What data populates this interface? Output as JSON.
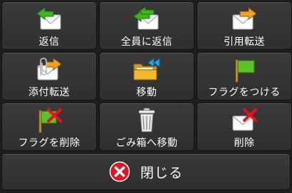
{
  "menu": {
    "items": [
      {
        "label": "返信",
        "icon": "reply-icon"
      },
      {
        "label": "全員に返信",
        "icon": "reply-all-icon"
      },
      {
        "label": "引用転送",
        "icon": "forward-quote-icon"
      },
      {
        "label": "添付転送",
        "icon": "forward-attachment-icon"
      },
      {
        "label": "移動",
        "icon": "move-folder-icon"
      },
      {
        "label": "フラグをつける",
        "icon": "flag-icon"
      },
      {
        "label": "フラグを削除",
        "icon": "remove-flag-icon"
      },
      {
        "label": "ごみ箱へ移動",
        "icon": "trash-icon"
      },
      {
        "label": "削除",
        "icon": "delete-mail-icon"
      }
    ],
    "close_label": "閉じる",
    "close_icon": "close-icon"
  },
  "colors": {
    "envelope": "#ffffff",
    "arrow_green": "#3cb81c",
    "arrow_orange": "#f5a21b",
    "folder": "#f2b828",
    "arrow_blue": "#2aa4e8",
    "flag_green": "#5cc02a",
    "red_x": "#e8101c"
  }
}
